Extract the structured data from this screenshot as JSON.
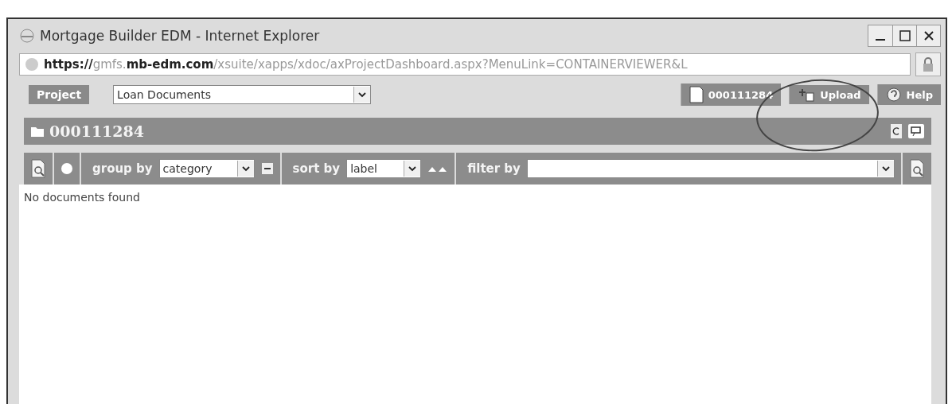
{
  "window": {
    "title": "Mortgage Builder EDM - Internet Explorer"
  },
  "address_bar": {
    "url_parts": [
      {
        "text": "https://",
        "kind": "dark"
      },
      {
        "text": "gmfs.",
        "kind": "faint"
      },
      {
        "text": "mb-edm.com",
        "kind": "dark"
      },
      {
        "text": "/xsuite/xapps/xdoc/axProjectDashboard.aspx?MenuLink=CONTAINERVIEWER&L",
        "kind": "faint"
      }
    ]
  },
  "toolbar": {
    "project_label": "Project",
    "project_value": "Loan Documents",
    "items": [
      {
        "label": "000111284",
        "kind": "document"
      },
      {
        "label": "Upload",
        "kind": "upload"
      },
      {
        "label": "Help",
        "kind": "help"
      }
    ]
  },
  "folder": {
    "title": "000111284"
  },
  "list_toolbar": {
    "group_by_label": "group by",
    "group_by_value": "category",
    "sort_by_label": "sort by",
    "sort_by_value": "label",
    "filter_by_label": "filter by"
  },
  "message": "No documents found",
  "annotation": {
    "kind": "circle"
  }
}
